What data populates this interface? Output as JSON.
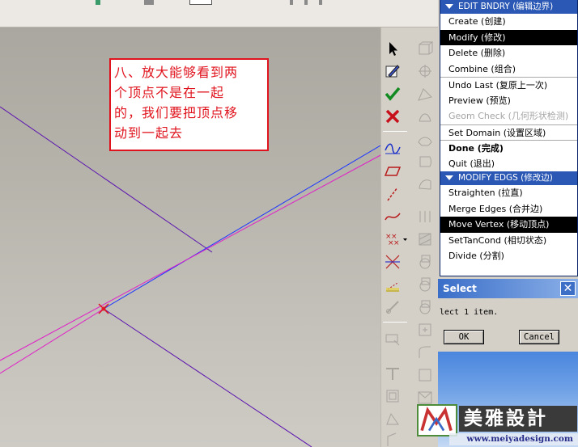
{
  "annotation": {
    "text": "八、放大能够看到两\n个顶点不是在一起\n的，我们要把顶点移\n动到一起去"
  },
  "menu": {
    "edit_bndry": {
      "header": "EDIT BNDRY (编辑边界)",
      "items": [
        {
          "label": "Create (创建)",
          "state": "normal"
        },
        {
          "label": "Modify (修改)",
          "state": "selected"
        },
        {
          "label": "Delete (删除)",
          "state": "normal"
        },
        {
          "label": "Combine (组合)",
          "state": "normal"
        },
        {
          "label": "Undo Last (复原上一次)",
          "state": "normal"
        },
        {
          "label": "Preview (预览)",
          "state": "normal"
        },
        {
          "label": "Geom Check (几何形状检测)",
          "state": "disabled"
        },
        {
          "label": "Set Domain (设置区域)",
          "state": "normal"
        },
        {
          "label": "Done (完成)",
          "state": "bold"
        },
        {
          "label": "Quit (退出)",
          "state": "normal"
        }
      ]
    },
    "modify_edgs": {
      "header": "MODIFY EDGS (修改边)",
      "items": [
        {
          "label": "Straighten (拉直)",
          "state": "normal"
        },
        {
          "label": "Merge Edges (合并边)",
          "state": "normal"
        },
        {
          "label": "Move Vertex (移动顶点)",
          "state": "selected"
        },
        {
          "label": "SetTanCond (相切状态)",
          "state": "normal"
        },
        {
          "label": "Divide (分割)",
          "state": "normal"
        }
      ]
    }
  },
  "select_dialog": {
    "title": "Select",
    "close_glyph": "✕",
    "message": "lect 1 item.",
    "ok_label": "OK",
    "cancel_label": "Cancel"
  },
  "watermark": {
    "brand": "美雅設計",
    "url": "www.meiyadesign.com"
  },
  "colors": {
    "menu_header": "#2a58b4",
    "annotation_red": "#e0141e",
    "curve_blue": "#1a34ff",
    "curve_magenta": "#e020c8",
    "curve_purple": "#5a10b0"
  }
}
